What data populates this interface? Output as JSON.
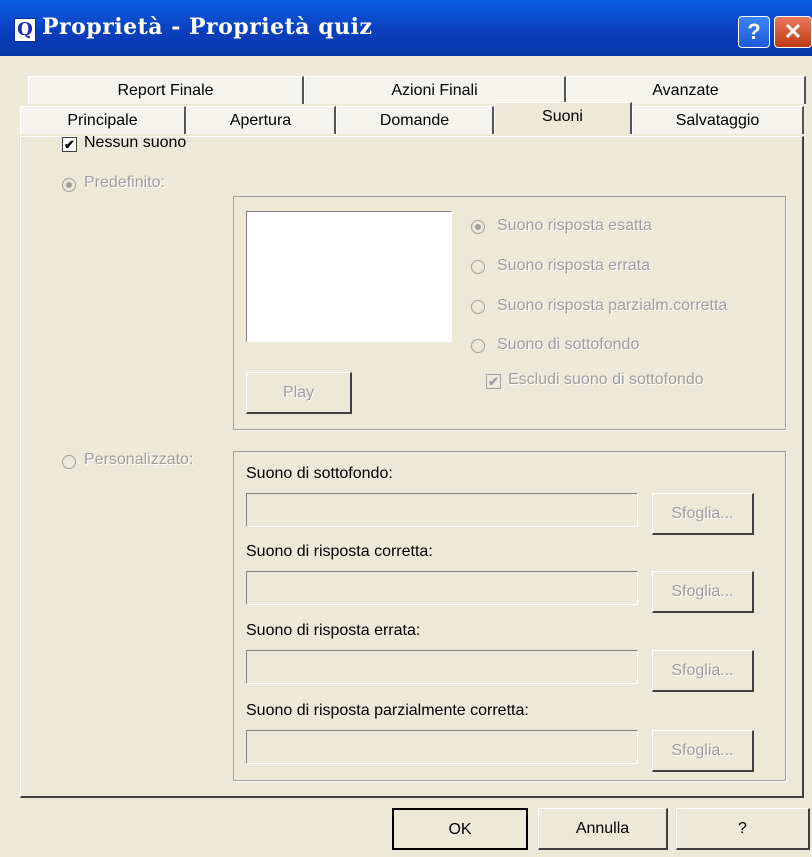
{
  "window": {
    "title": "Proprietà - Proprietà quiz",
    "app_icon_letter": "Q",
    "help_glyph": "?",
    "close_glyph": "✕"
  },
  "tabs": {
    "row_back": [
      "Report Finale",
      "Azioni Finali",
      "Avanzate"
    ],
    "row_front": [
      "Principale",
      "Apertura",
      "Domande",
      "Suoni",
      "Salvataggio"
    ],
    "active": "Suoni"
  },
  "sounds": {
    "no_sound": {
      "label": "Nessun suono",
      "checked": true
    },
    "predefined": {
      "label": "Predefinito:",
      "selected": true
    },
    "options": [
      {
        "label": "Suono risposta esatta",
        "selected": true
      },
      {
        "label": "Suono risposta errata",
        "selected": false
      },
      {
        "label": "Suono risposta parzialm.corretta",
        "selected": false
      },
      {
        "label": "Suono di sottofondo",
        "selected": false
      }
    ],
    "exclude_background": {
      "label": "Escludi suono di sottofondo",
      "checked": true
    },
    "play_label": "Play",
    "custom": {
      "label": "Personalizzato:",
      "selected": false
    },
    "custom_fields": [
      {
        "label": "Suono di sottofondo:",
        "value": "",
        "browse": "Sfoglia..."
      },
      {
        "label": "Suono di risposta corretta:",
        "value": "",
        "browse": "Sfoglia..."
      },
      {
        "label": "Suono di risposta errata:",
        "value": "",
        "browse": "Sfoglia..."
      },
      {
        "label": "Suono di risposta parzialmente corretta:",
        "value": "",
        "browse": "Sfoglia..."
      }
    ]
  },
  "footer": {
    "ok": "OK",
    "cancel": "Annulla",
    "help": "?"
  }
}
